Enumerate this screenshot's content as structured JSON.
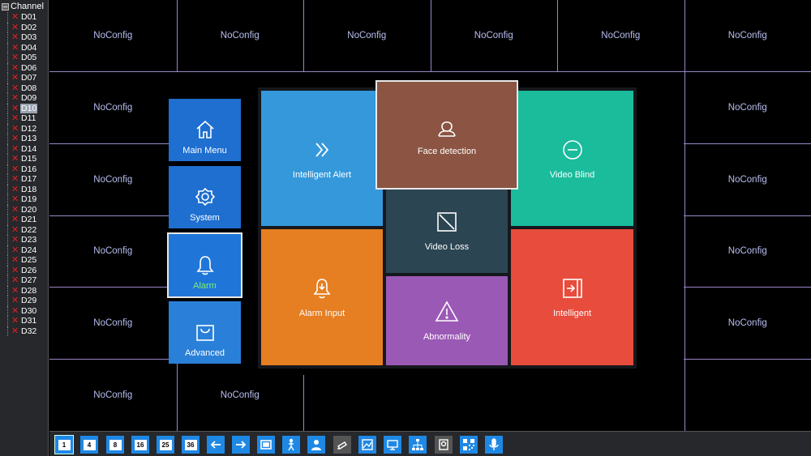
{
  "sidebar": {
    "title": "Channel",
    "selected": "D10",
    "channels": [
      "D01",
      "D02",
      "D03",
      "D04",
      "D05",
      "D06",
      "D07",
      "D08",
      "D09",
      "D10",
      "D11",
      "D12",
      "D13",
      "D14",
      "D15",
      "D16",
      "D17",
      "D18",
      "D19",
      "D20",
      "D21",
      "D22",
      "D23",
      "D24",
      "D25",
      "D26",
      "D27",
      "D28",
      "D29",
      "D30",
      "D31",
      "D32"
    ]
  },
  "grid": {
    "cell_label": "NoConfig"
  },
  "side_menu": {
    "main_menu": "Main Menu",
    "system": "System",
    "alarm": "Alarm",
    "advanced": "Advanced"
  },
  "alarm_panel": {
    "intelligent_alert": "Intelligent Alert",
    "face_detection": "Face detection",
    "video_blind": "Video Blind",
    "video_loss": "Video Loss",
    "alarm_input": "Alarm Input",
    "intelligent": "Intelligent",
    "abnormality": "Abnormality"
  },
  "toolbar": {
    "split_labels": [
      "1",
      "4",
      "8",
      "16",
      "25",
      "36"
    ]
  },
  "colors": {
    "menu_blue": "#1e6fd0",
    "active_text": "#7cf069",
    "intelligent_alert": "#3498db",
    "face_detection": "#8b5443",
    "video_blind": "#1abc9c",
    "video_loss": "#2c4553",
    "alarm_input": "#e67e22",
    "intelligent": "#e74c3c",
    "abnormality": "#9b59b6"
  }
}
